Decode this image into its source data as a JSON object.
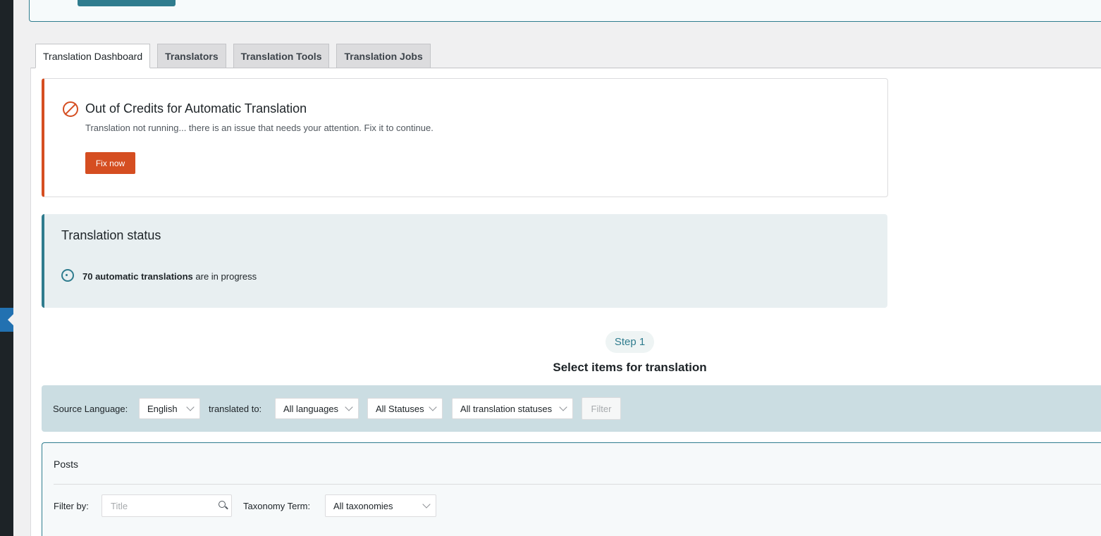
{
  "tabs": [
    {
      "label": "Translation Dashboard",
      "active": true
    },
    {
      "label": "Translators",
      "active": false
    },
    {
      "label": "Translation Tools",
      "active": false
    },
    {
      "label": "Translation Jobs",
      "active": false
    }
  ],
  "credits_notice": {
    "title": "Out of Credits for Automatic Translation",
    "message": "Translation not running... there is an issue that needs your attention. Fix it to continue.",
    "button": "Fix now",
    "icon": "ban-icon",
    "color": "#d54e21"
  },
  "status": {
    "title": "Translation status",
    "count_text": "70 automatic translations",
    "suffix": " are in progress",
    "icon": "spinner-icon"
  },
  "step": {
    "pill": "Step 1",
    "title": "Select items for translation"
  },
  "filter_bar": {
    "source_label": "Source Language:",
    "source_value": "English",
    "translated_label": "translated to:",
    "languages_value": "All languages",
    "statuses_value": "All Statuses",
    "translation_statuses_value": "All translation statuses",
    "filter_button": "Filter"
  },
  "posts": {
    "title": "Posts",
    "filter_label": "Filter by:",
    "title_placeholder": "Title",
    "taxonomy_label": "Taxonomy Term:",
    "taxonomy_value": "All taxonomies"
  },
  "colors": {
    "accent": "#2f7c8e",
    "error": "#d54e21"
  }
}
